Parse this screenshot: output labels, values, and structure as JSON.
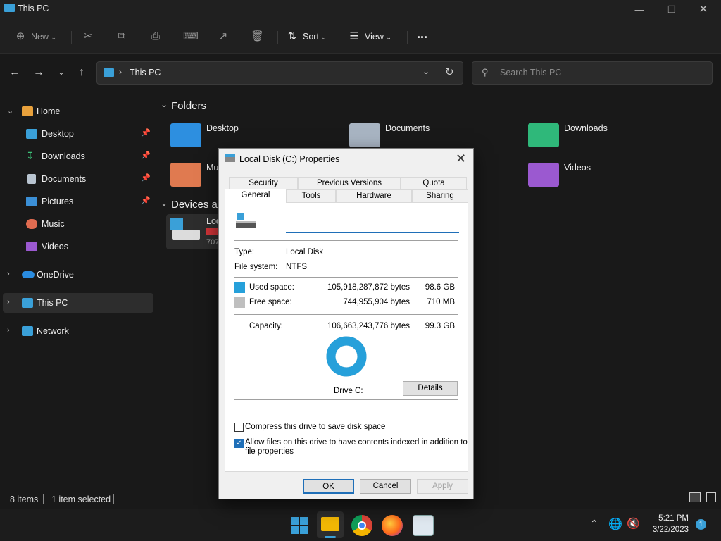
{
  "window": {
    "title": "This PC"
  },
  "toolbar": {
    "new": "New",
    "sort": "Sort",
    "view": "View",
    "more": "..."
  },
  "address": {
    "path": "This PC",
    "search_placeholder": "Search This PC"
  },
  "sidebar": {
    "items": [
      {
        "label": "Home"
      },
      {
        "label": "Desktop"
      },
      {
        "label": "Downloads"
      },
      {
        "label": "Documents"
      },
      {
        "label": "Pictures"
      },
      {
        "label": "Music"
      },
      {
        "label": "Videos"
      },
      {
        "label": "OneDrive"
      },
      {
        "label": "This PC"
      },
      {
        "label": "Network"
      }
    ]
  },
  "content": {
    "folders_header": "Folders",
    "folders": [
      {
        "name": "Desktop"
      },
      {
        "name": "Documents"
      },
      {
        "name": "Downloads"
      },
      {
        "name": "Mu"
      },
      {
        "name": "Videos"
      }
    ],
    "devices_header": "Devices ar",
    "drive_label": "Loc",
    "drive_sub": "707"
  },
  "status": {
    "items": "8 items",
    "selected": "1 item selected"
  },
  "dialog": {
    "title": "Local Disk (C:) Properties",
    "tabs_top": [
      "Security",
      "Previous Versions",
      "Quota"
    ],
    "tabs_bottom": [
      "General",
      "Tools",
      "Hardware",
      "Sharing"
    ],
    "name_value": "",
    "type_label": "Type:",
    "type_value": "Local Disk",
    "fs_label": "File system:",
    "fs_value": "NTFS",
    "used_label": "Used space:",
    "used_bytes": "105,918,287,872 bytes",
    "used_gb": "98.6 GB",
    "free_label": "Free space:",
    "free_bytes": "744,955,904 bytes",
    "free_gb": "710 MB",
    "capacity_label": "Capacity:",
    "capacity_bytes": "106,663,243,776 bytes",
    "capacity_gb": "99.3 GB",
    "used_fraction": 0.993,
    "drive_caption": "Drive C:",
    "details": "Details",
    "compress": "Compress this drive to save disk space",
    "index_line1": "Allow files on this drive to have contents indexed in addition to",
    "index_line2": "file properties",
    "compress_checked": false,
    "index_checked": true,
    "ok": "OK",
    "cancel": "Cancel",
    "apply": "Apply",
    "used_color": "#26a0da",
    "free_color": "#bfbfbf"
  },
  "taskbar": {
    "time": "5:21 PM",
    "date": "3/22/2023",
    "notifications": "1"
  }
}
